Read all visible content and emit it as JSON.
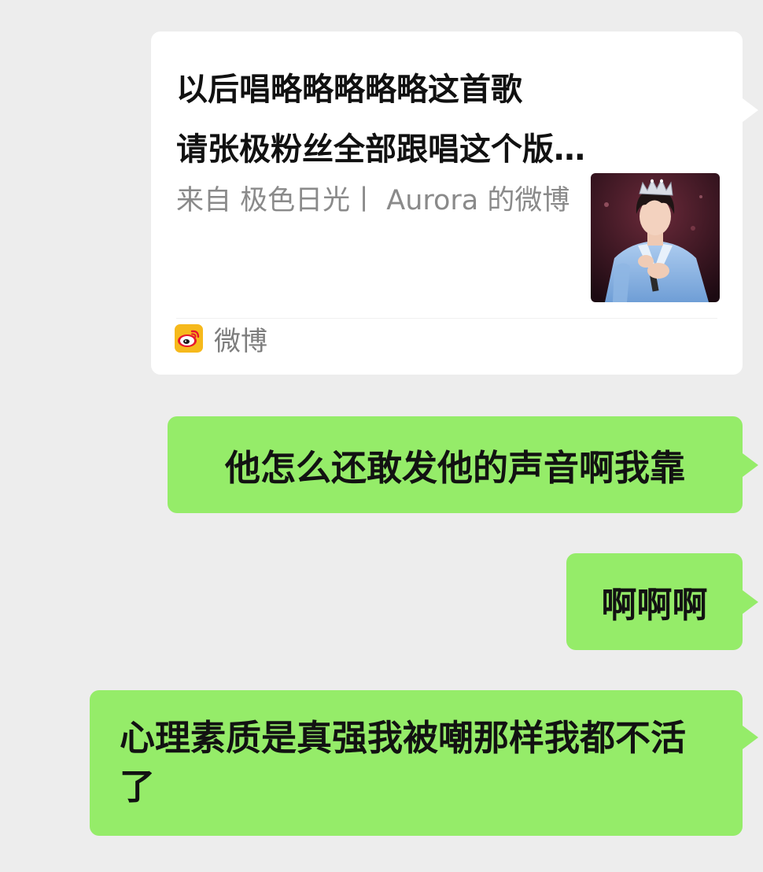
{
  "share_card": {
    "title_line1": "以后唱略略略略略这首歌",
    "title_line2": "请张极粉丝全部跟唱这个版…",
    "source": "来自 极色日光丨 Aurora 的微博",
    "app_name": "微博",
    "app_icon": "weibo-logo-icon",
    "thumbnail": "performer-photo"
  },
  "messages": [
    {
      "text": "他怎么还敢发他的声音啊我靠"
    },
    {
      "text": "啊啊啊"
    },
    {
      "text": "心理素质是真强我被嘲那样我都不活了"
    }
  ],
  "colors": {
    "background": "#ededed",
    "sent_bubble": "#95ec69",
    "card": "#ffffff"
  }
}
